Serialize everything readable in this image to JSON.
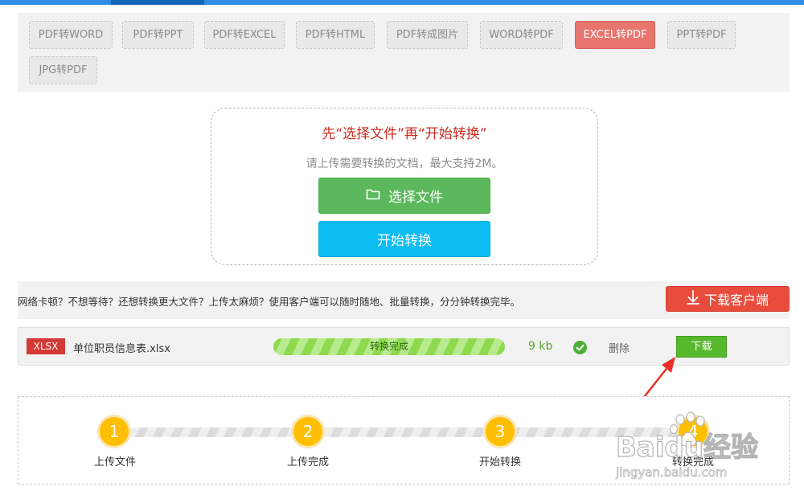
{
  "tabs": [
    {
      "label": "PDF转WORD",
      "active": false
    },
    {
      "label": "PDF转PPT",
      "active": false
    },
    {
      "label": "PDF转EXCEL",
      "active": false
    },
    {
      "label": "PDF转HTML",
      "active": false
    },
    {
      "label": "PDF转成图片",
      "active": false
    },
    {
      "label": "WORD转PDF",
      "active": false
    },
    {
      "label": "EXCEL转PDF",
      "active": true
    },
    {
      "label": "PPT转PDF",
      "active": false
    },
    {
      "label": "JPG转PDF",
      "active": false
    }
  ],
  "upload": {
    "title": "先“选择文件”再“开始转换”",
    "hint": "请上传需要转换的文档，最大支持2M。",
    "select_button": "选择文件",
    "start_button": "开始转换"
  },
  "client_bar": {
    "text": "网络卡顿？不想等待？还想转换更大文件？上传太麻烦？使用客户端可以随时随地、批量转换，分分钟转换完毕。",
    "download_button": "下载客户端"
  },
  "file": {
    "type_badge": "XLSX",
    "name": "单位职员信息表.xlsx",
    "progress_label": "转换完成",
    "progress_percent": 100,
    "size": "9 kb",
    "delete_label": "删除",
    "download_label": "下载"
  },
  "steps": [
    {
      "number": "1",
      "label": "上传文件"
    },
    {
      "number": "2",
      "label": "上传完成"
    },
    {
      "number": "3",
      "label": "开始转换"
    },
    {
      "number": "4",
      "label": "转换完成"
    }
  ],
  "watermark": {
    "brand": "Baidu经验",
    "url": "jingyan.baidu.com"
  },
  "colors": {
    "accent_blue": "#2e8ee0",
    "active_tab": "#e8766e",
    "select_green": "#5cb85c",
    "start_cyan": "#0dbcf2",
    "client_red": "#e74c3c",
    "step_yellow": "#ffbf00",
    "arrow_red": "#e8302a"
  }
}
